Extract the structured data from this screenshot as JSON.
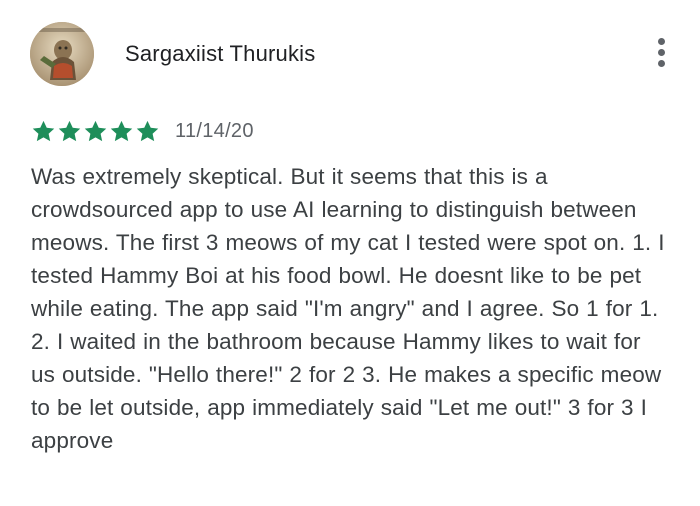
{
  "review": {
    "author": "Sargaxiist Thurukis",
    "avatar_icon": "profile-photo",
    "more_icon": "more-vert-icon",
    "rating": 5,
    "max_rating": 5,
    "star_color": "#1e8e5a",
    "date": "11/14/20",
    "text": "Was extremely skeptical. But it seems that this is a crowdsourced app to use AI learning to distinguish between meows. The first 3 meows of my cat I tested were spot on. 1. I tested Hammy Boi at his food bowl. He doesnt like to be pet while eating. The app said \"I'm angry\" and I agree. So 1 for 1. 2. I waited in the bathroom because Hammy likes to wait for us outside. \"Hello there!\" 2 for 2 3. He makes a specific meow to be let outside, app immediately said \"Let me out!\" 3 for 3 I approve"
  }
}
